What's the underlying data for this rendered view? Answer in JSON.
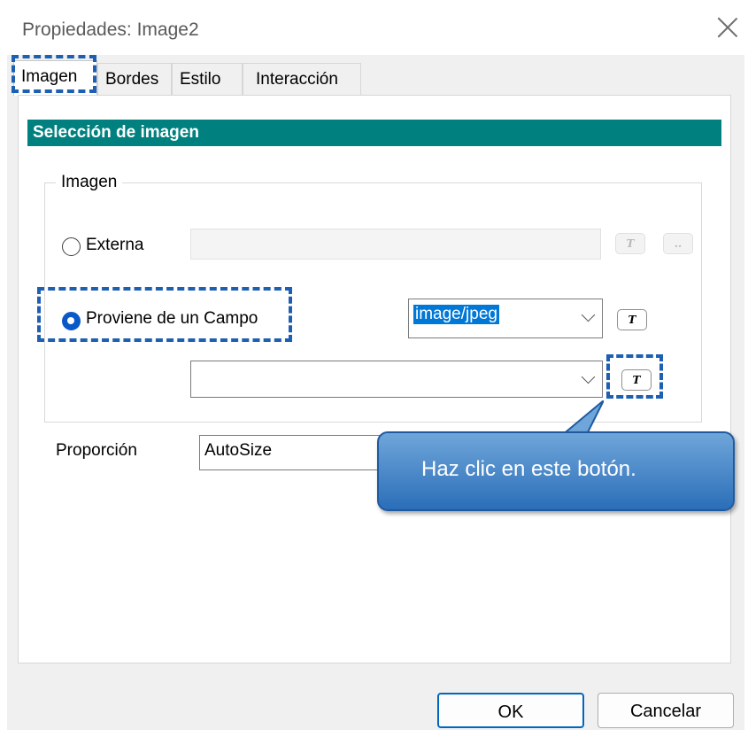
{
  "window": {
    "title": "Propiedades: Image2"
  },
  "tabs": [
    {
      "label": "Imagen"
    },
    {
      "label": "Bordes"
    },
    {
      "label": "Estilo"
    },
    {
      "label": "Interacción"
    }
  ],
  "section": {
    "title": "Selección de imagen"
  },
  "image_group": {
    "label": "Imagen",
    "external": {
      "label": "Externa",
      "selected": false
    },
    "from_field": {
      "label": "Proviene de un Campo",
      "selected": true,
      "mime_value": "image/jpeg",
      "field_value": ""
    },
    "expr_button_label": "T",
    "browse_button_label": ".."
  },
  "proportion": {
    "label": "Proporción",
    "value": "AutoSize"
  },
  "callout": {
    "text": "Haz clic en este botón."
  },
  "footer": {
    "ok_label": "OK",
    "cancel_label": "Cancelar"
  },
  "colors": {
    "section_bar": "#00807e",
    "highlight": "#1d5fb0",
    "callout": "#3c7fc4",
    "selection": "#0078d7"
  }
}
